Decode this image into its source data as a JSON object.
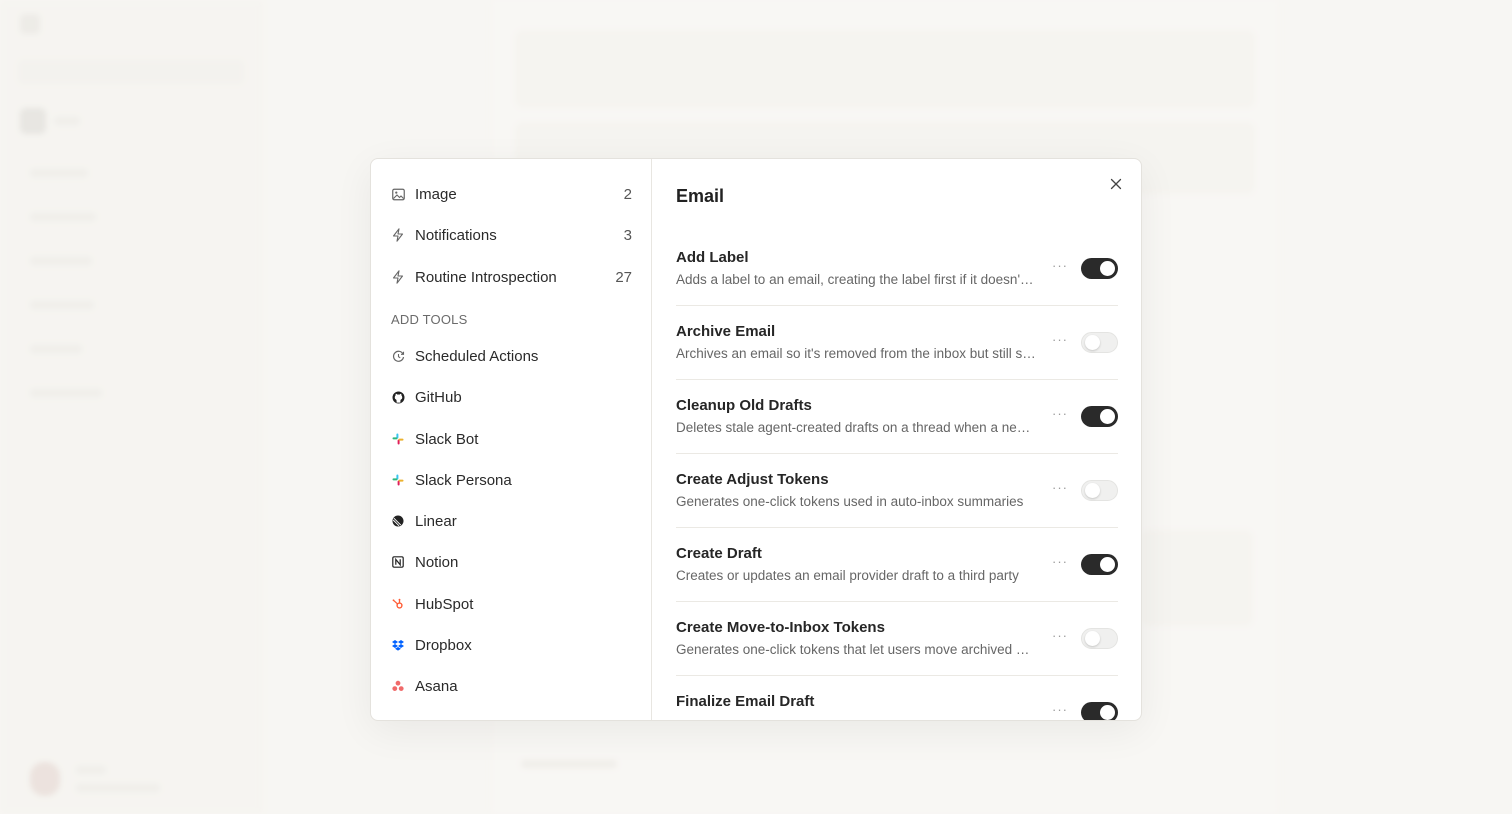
{
  "modal": {
    "nav": {
      "items": [
        {
          "label": "Image",
          "count": "2",
          "icon": "image-icon"
        },
        {
          "label": "Notifications",
          "count": "3",
          "icon": "bolt-icon"
        },
        {
          "label": "Routine Introspection",
          "count": "27",
          "icon": "bolt-icon"
        }
      ],
      "add_tools_header": "ADD TOOLS",
      "add_tools": [
        {
          "label": "Scheduled Actions",
          "icon": "clock-icon"
        },
        {
          "label": "GitHub",
          "icon": "github-icon"
        },
        {
          "label": "Slack Bot",
          "icon": "slack-icon"
        },
        {
          "label": "Slack Persona",
          "icon": "slack-icon"
        },
        {
          "label": "Linear",
          "icon": "linear-icon"
        },
        {
          "label": "Notion",
          "icon": "notion-icon"
        },
        {
          "label": "HubSpot",
          "icon": "hubspot-icon"
        },
        {
          "label": "Dropbox",
          "icon": "dropbox-icon"
        },
        {
          "label": "Asana",
          "icon": "asana-icon"
        }
      ]
    },
    "detail": {
      "title": "Email",
      "tools": [
        {
          "name": "Add Label",
          "description": "Adds a label to an email, creating the label first if it doesn't exist",
          "enabled": true
        },
        {
          "name": "Archive Email",
          "description": "Archives an email so it's removed from the inbox but still searchable",
          "enabled": false
        },
        {
          "name": "Cleanup Old Drafts",
          "description": "Deletes stale agent-created drafts on a thread when a new draft is created",
          "enabled": true
        },
        {
          "name": "Create Adjust Tokens",
          "description": "Generates one-click tokens used in auto-inbox summaries",
          "enabled": false
        },
        {
          "name": "Create Draft",
          "description": "Creates or updates an email provider draft to a third party",
          "enabled": true
        },
        {
          "name": "Create Move-to-Inbox Tokens",
          "description": "Generates one-click tokens that let users move archived emails back",
          "enabled": false
        },
        {
          "name": "Finalize Email Draft",
          "description": "",
          "enabled": true
        }
      ],
      "more_label": "···"
    }
  },
  "colors": {
    "toggle_on": "#2a2a2a",
    "toggle_off": "#f0f0ef",
    "background": "#f7f6f3"
  }
}
